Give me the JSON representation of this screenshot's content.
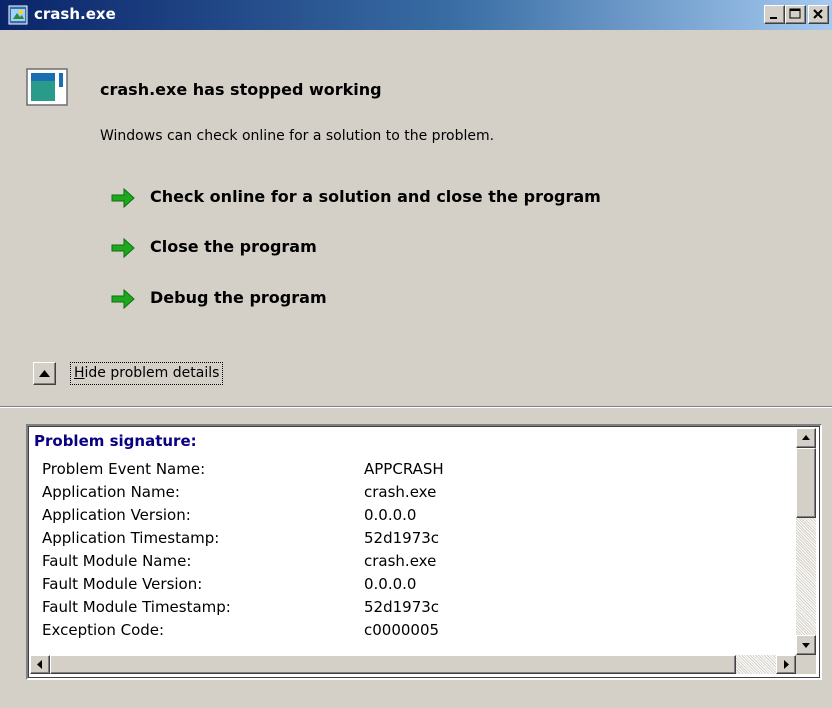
{
  "window": {
    "title": "crash.exe"
  },
  "dialog": {
    "heading": "crash.exe has stopped working",
    "subtext": "Windows can check online for a solution to the problem.",
    "commands": [
      {
        "label": "Check online for a solution and close the program"
      },
      {
        "label": "Close the program"
      },
      {
        "label": "Debug the program"
      }
    ],
    "details_toggle_label_accel": "H",
    "details_toggle_label_rest": "ide problem details"
  },
  "details": {
    "header": "Problem signature:",
    "rows": [
      {
        "key": "Problem Event Name:",
        "value": "APPCRASH"
      },
      {
        "key": "Application Name:",
        "value": "crash.exe"
      },
      {
        "key": "Application Version:",
        "value": "0.0.0.0"
      },
      {
        "key": "Application Timestamp:",
        "value": "52d1973c"
      },
      {
        "key": "Fault Module Name:",
        "value": "crash.exe"
      },
      {
        "key": "Fault Module Version:",
        "value": "0.0.0.0"
      },
      {
        "key": "Fault Module Timestamp:",
        "value": "52d1973c"
      },
      {
        "key": "Exception Code:",
        "value": "c0000005"
      }
    ]
  },
  "colors": {
    "titlebar_start": "#0a246a",
    "titlebar_end": "#a6caf0",
    "window_bg": "#d4d0c8",
    "signature_header": "#0a0080",
    "arrow_green": "#1ea81e"
  },
  "icons": {
    "title": "app-window-icon",
    "app": "application-icon",
    "command": "green-arrow-icon",
    "toggle": "collapse-up-arrow-icon"
  }
}
